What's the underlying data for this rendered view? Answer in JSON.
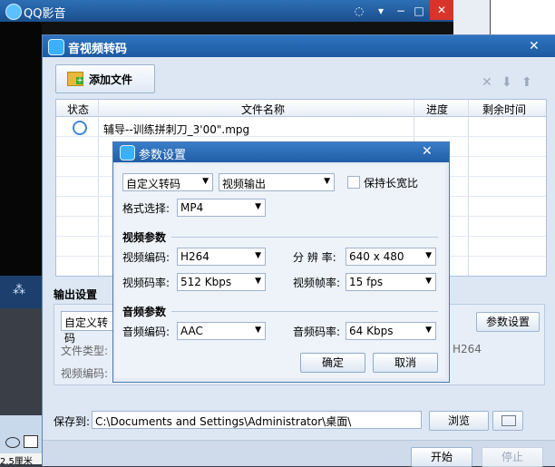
{
  "qq_player": {
    "title": "QQ影音",
    "controls": [
      "chat-icon",
      "minimize-icon",
      "restore-icon",
      "close-icon"
    ]
  },
  "converter": {
    "title": "音视频转码",
    "add_file_label": "添加文件",
    "table": {
      "headers": [
        "状态",
        "文件名称",
        "进度",
        "剩余时间"
      ],
      "rows": [
        {
          "status_icon": "clock-icon",
          "name": "辅导--训练拼刺刀_3'00\".mpg",
          "progress": "",
          "remaining": ""
        }
      ]
    },
    "output": {
      "title": "输出设置",
      "preset": "自定义转码",
      "file_type_label": "文件类型:",
      "video_codec_label": "视频编码:",
      "codec_value": "H264",
      "param_button": "参数设置"
    },
    "save": {
      "label": "保存到:",
      "path": "C:\\Documents and Settings\\Administrator\\桌面\\",
      "browse": "浏览"
    },
    "start": "开始",
    "stop": "停止"
  },
  "dialog": {
    "title": "参数设置",
    "mode": "自定义转码",
    "output_type": "视频输出",
    "keep_ratio_label": "保持长宽比",
    "format_label": "格式选择:",
    "format_value": "MP4",
    "video_section": "视频参数",
    "video_codec_label": "视频编码:",
    "video_codec": "H264",
    "resolution_label": "分 辨 率:",
    "resolution": "640 x 480",
    "video_bitrate_label": "视频码率:",
    "video_bitrate": "512 Kbps",
    "frame_rate_label": "视频帧率:",
    "frame_rate": "15 fps",
    "audio_section": "音频参数",
    "audio_codec_label": "音频编码:",
    "audio_codec": "AAC",
    "audio_bitrate_label": "音频码率:",
    "audio_bitrate": "64 Kbps",
    "ok": "确定",
    "cancel": "取消"
  },
  "office": {
    "ruler_text": "2.5厘米"
  }
}
